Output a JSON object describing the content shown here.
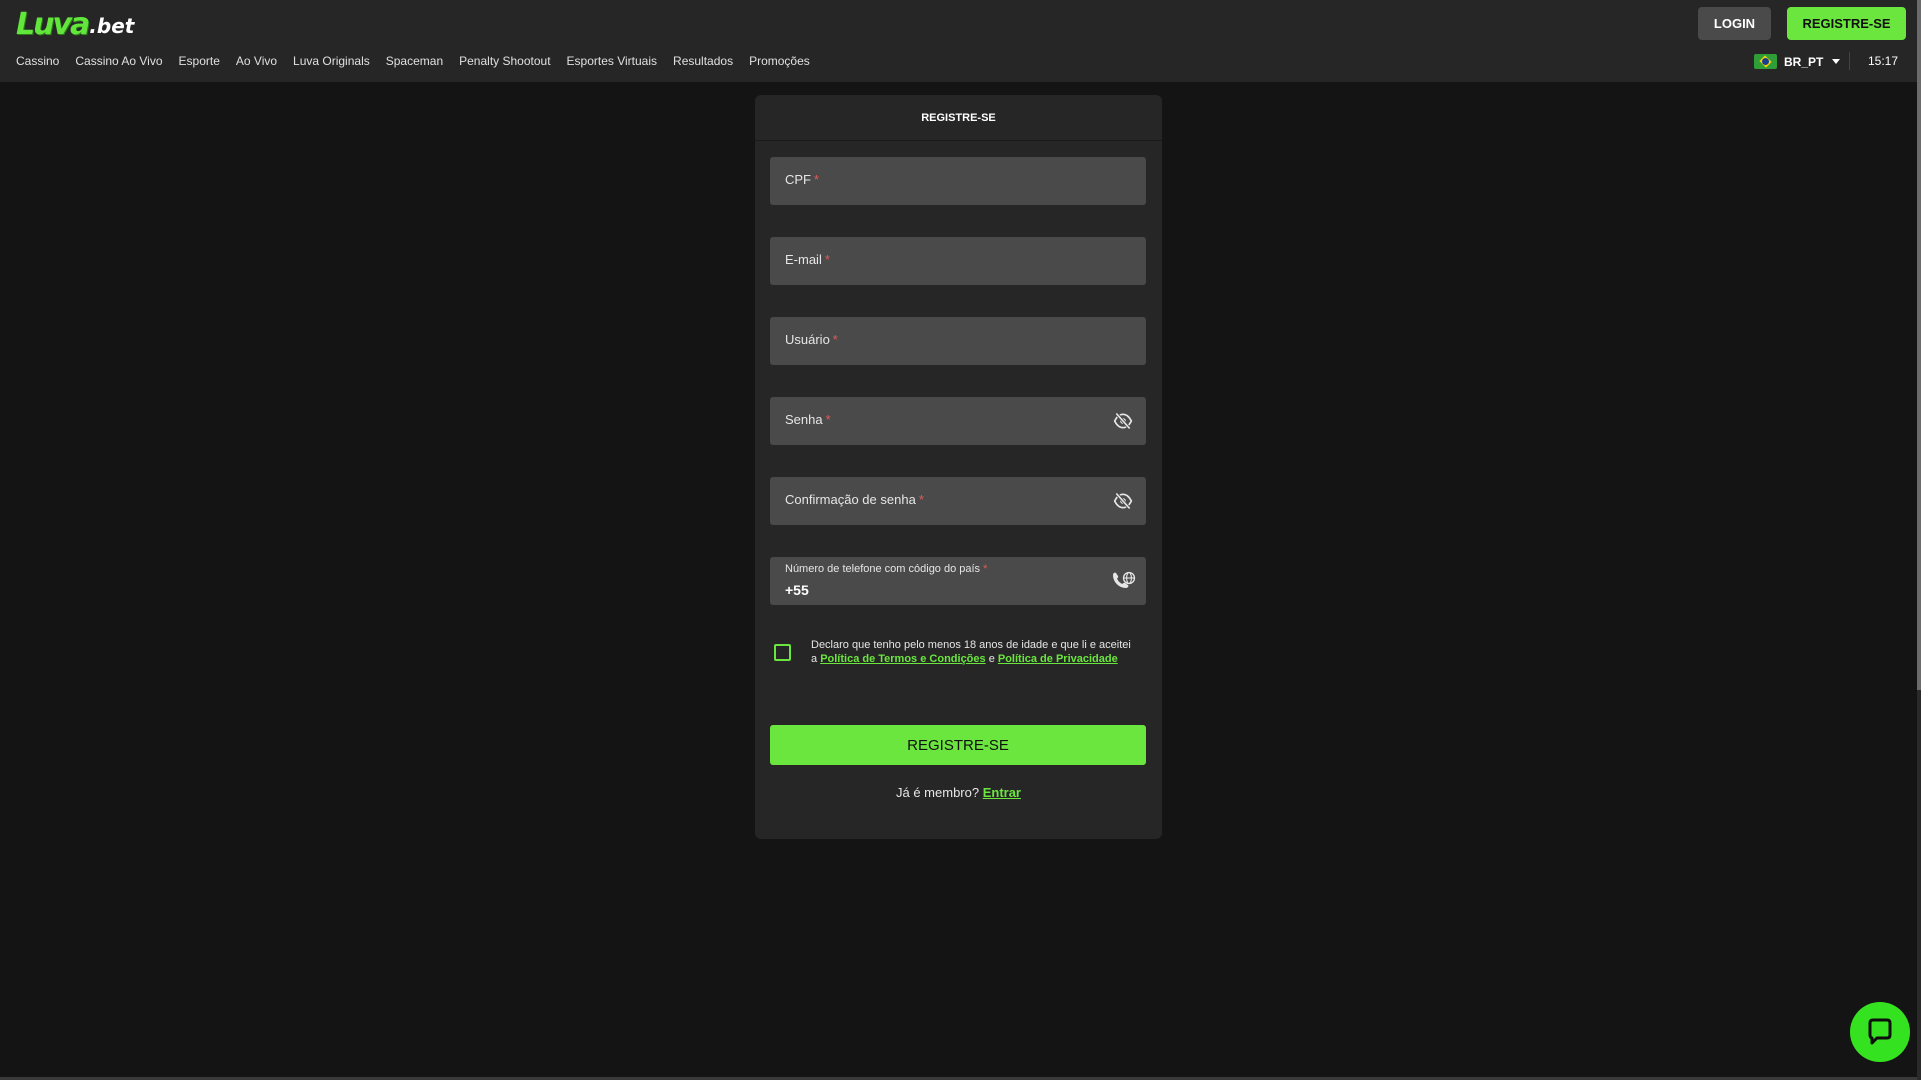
{
  "header": {
    "logo_mark": "Luva",
    "logo_text": ".bet",
    "login_label": "LOGIN",
    "register_label": "REGISTRE-SE",
    "nav": [
      "Cassino",
      "Cassino Ao Vivo",
      "Esporte",
      "Ao Vivo",
      "Luva Originals",
      "Spaceman",
      "Penalty Shootout",
      "Esportes Virtuais",
      "Resultados",
      "Promoções"
    ],
    "language": "BR_PT",
    "time": "15:17"
  },
  "form": {
    "title": "REGISTRE-SE",
    "cpf_label": "CPF",
    "email_label": "E-mail",
    "user_label": "Usuário",
    "password_label": "Senha",
    "confirm_label": "Confirmação de senha",
    "phone_label": "Número de telefone com código do país",
    "phone_value": "+55",
    "required_mark": "*",
    "terms_prefix": "Declaro que tenho pelo menos 18 anos de idade e que li e aceitei a ",
    "terms_link": "Política de Termos e Condições",
    "terms_and": " e ",
    "privacy_link": "Política de Privacidade",
    "submit_label": "REGISTRE-SE",
    "member_text": "Já é membro? ",
    "login_link": "Entrar"
  },
  "colors": {
    "accent": "#6be63f",
    "background": "#141414",
    "card": "#262626",
    "field": "#4a4a4a"
  },
  "icons": {
    "password_toggle": "eye-off-icon",
    "phone": "phone-globe-icon",
    "chat": "chat-bubble-icon"
  }
}
